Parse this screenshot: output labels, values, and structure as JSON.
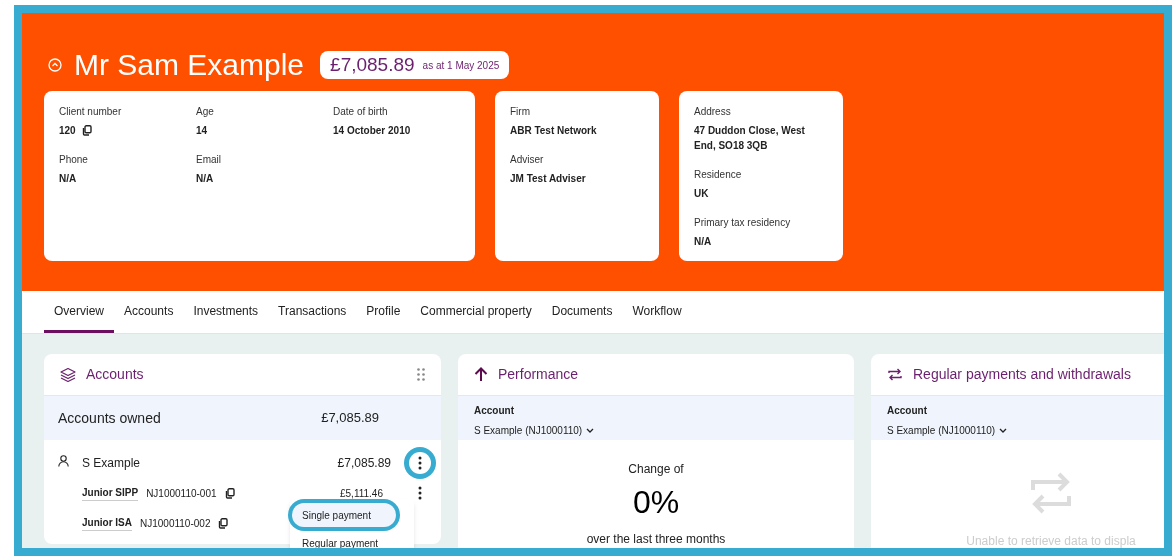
{
  "client": {
    "name": "Mr Sam Example",
    "balance": "£7,085.89",
    "as_at": "as at 1 May 2025"
  },
  "info_cards": [
    {
      "fields": [
        {
          "label": "Client number",
          "value": "120",
          "copyable": true
        },
        {
          "label": "Age",
          "value": "14",
          "copyable": false
        },
        {
          "label": "Date of birth",
          "value": "14 October 2010",
          "copyable": false
        },
        {
          "label": "Phone",
          "value": "N/A",
          "copyable": false
        },
        {
          "label": "Email",
          "value": "N/A",
          "copyable": false
        }
      ]
    },
    {
      "fields": [
        {
          "label": "Firm",
          "value": "ABR Test Network",
          "copyable": false
        },
        {
          "label": "Adviser",
          "value": "JM Test Adviser",
          "copyable": false
        }
      ]
    },
    {
      "fields": [
        {
          "label": "Address",
          "value": "47 Duddon Close, West End, SO18 3QB",
          "copyable": false
        },
        {
          "label": "Residence",
          "value": "UK",
          "copyable": false
        },
        {
          "label": "Primary tax residency",
          "value": "N/A",
          "copyable": false
        }
      ]
    }
  ],
  "tabs": [
    {
      "label": "Overview",
      "selected": true
    },
    {
      "label": "Accounts",
      "selected": false
    },
    {
      "label": "Investments",
      "selected": false
    },
    {
      "label": "Transactions",
      "selected": false
    },
    {
      "label": "Profile",
      "selected": false
    },
    {
      "label": "Commercial property",
      "selected": false
    },
    {
      "label": "Documents",
      "selected": false
    },
    {
      "label": "Workflow",
      "selected": false
    }
  ],
  "accounts_panel": {
    "title": "Accounts",
    "owned_label": "Accounts owned",
    "owned_total": "£7,085.89",
    "holder": {
      "name": "S Example",
      "total": "£7,085.89",
      "highlighted": true
    },
    "accounts": [
      {
        "type": "Junior SIPP",
        "number": "NJ1000110-001",
        "value": "£5,111.46",
        "menu": true
      },
      {
        "type": "Junior ISA",
        "number": "NJ1000110-002",
        "menu": false
      }
    ],
    "menu": [
      {
        "label": "Single payment",
        "highlighted": true
      },
      {
        "label": "Regular payment",
        "highlighted": false
      }
    ]
  },
  "performance_panel": {
    "title": "Performance",
    "account_label": "Account",
    "account_value": "S Example (NJ1000110)",
    "change_label": "Change of",
    "change_value": "0%",
    "period": "over the last three months"
  },
  "payments_panel": {
    "title": "Regular payments and withdrawals",
    "account_label": "Account",
    "account_value": "S Example (NJ1000110)",
    "empty_message": "Unable to retrieve data to displa"
  }
}
